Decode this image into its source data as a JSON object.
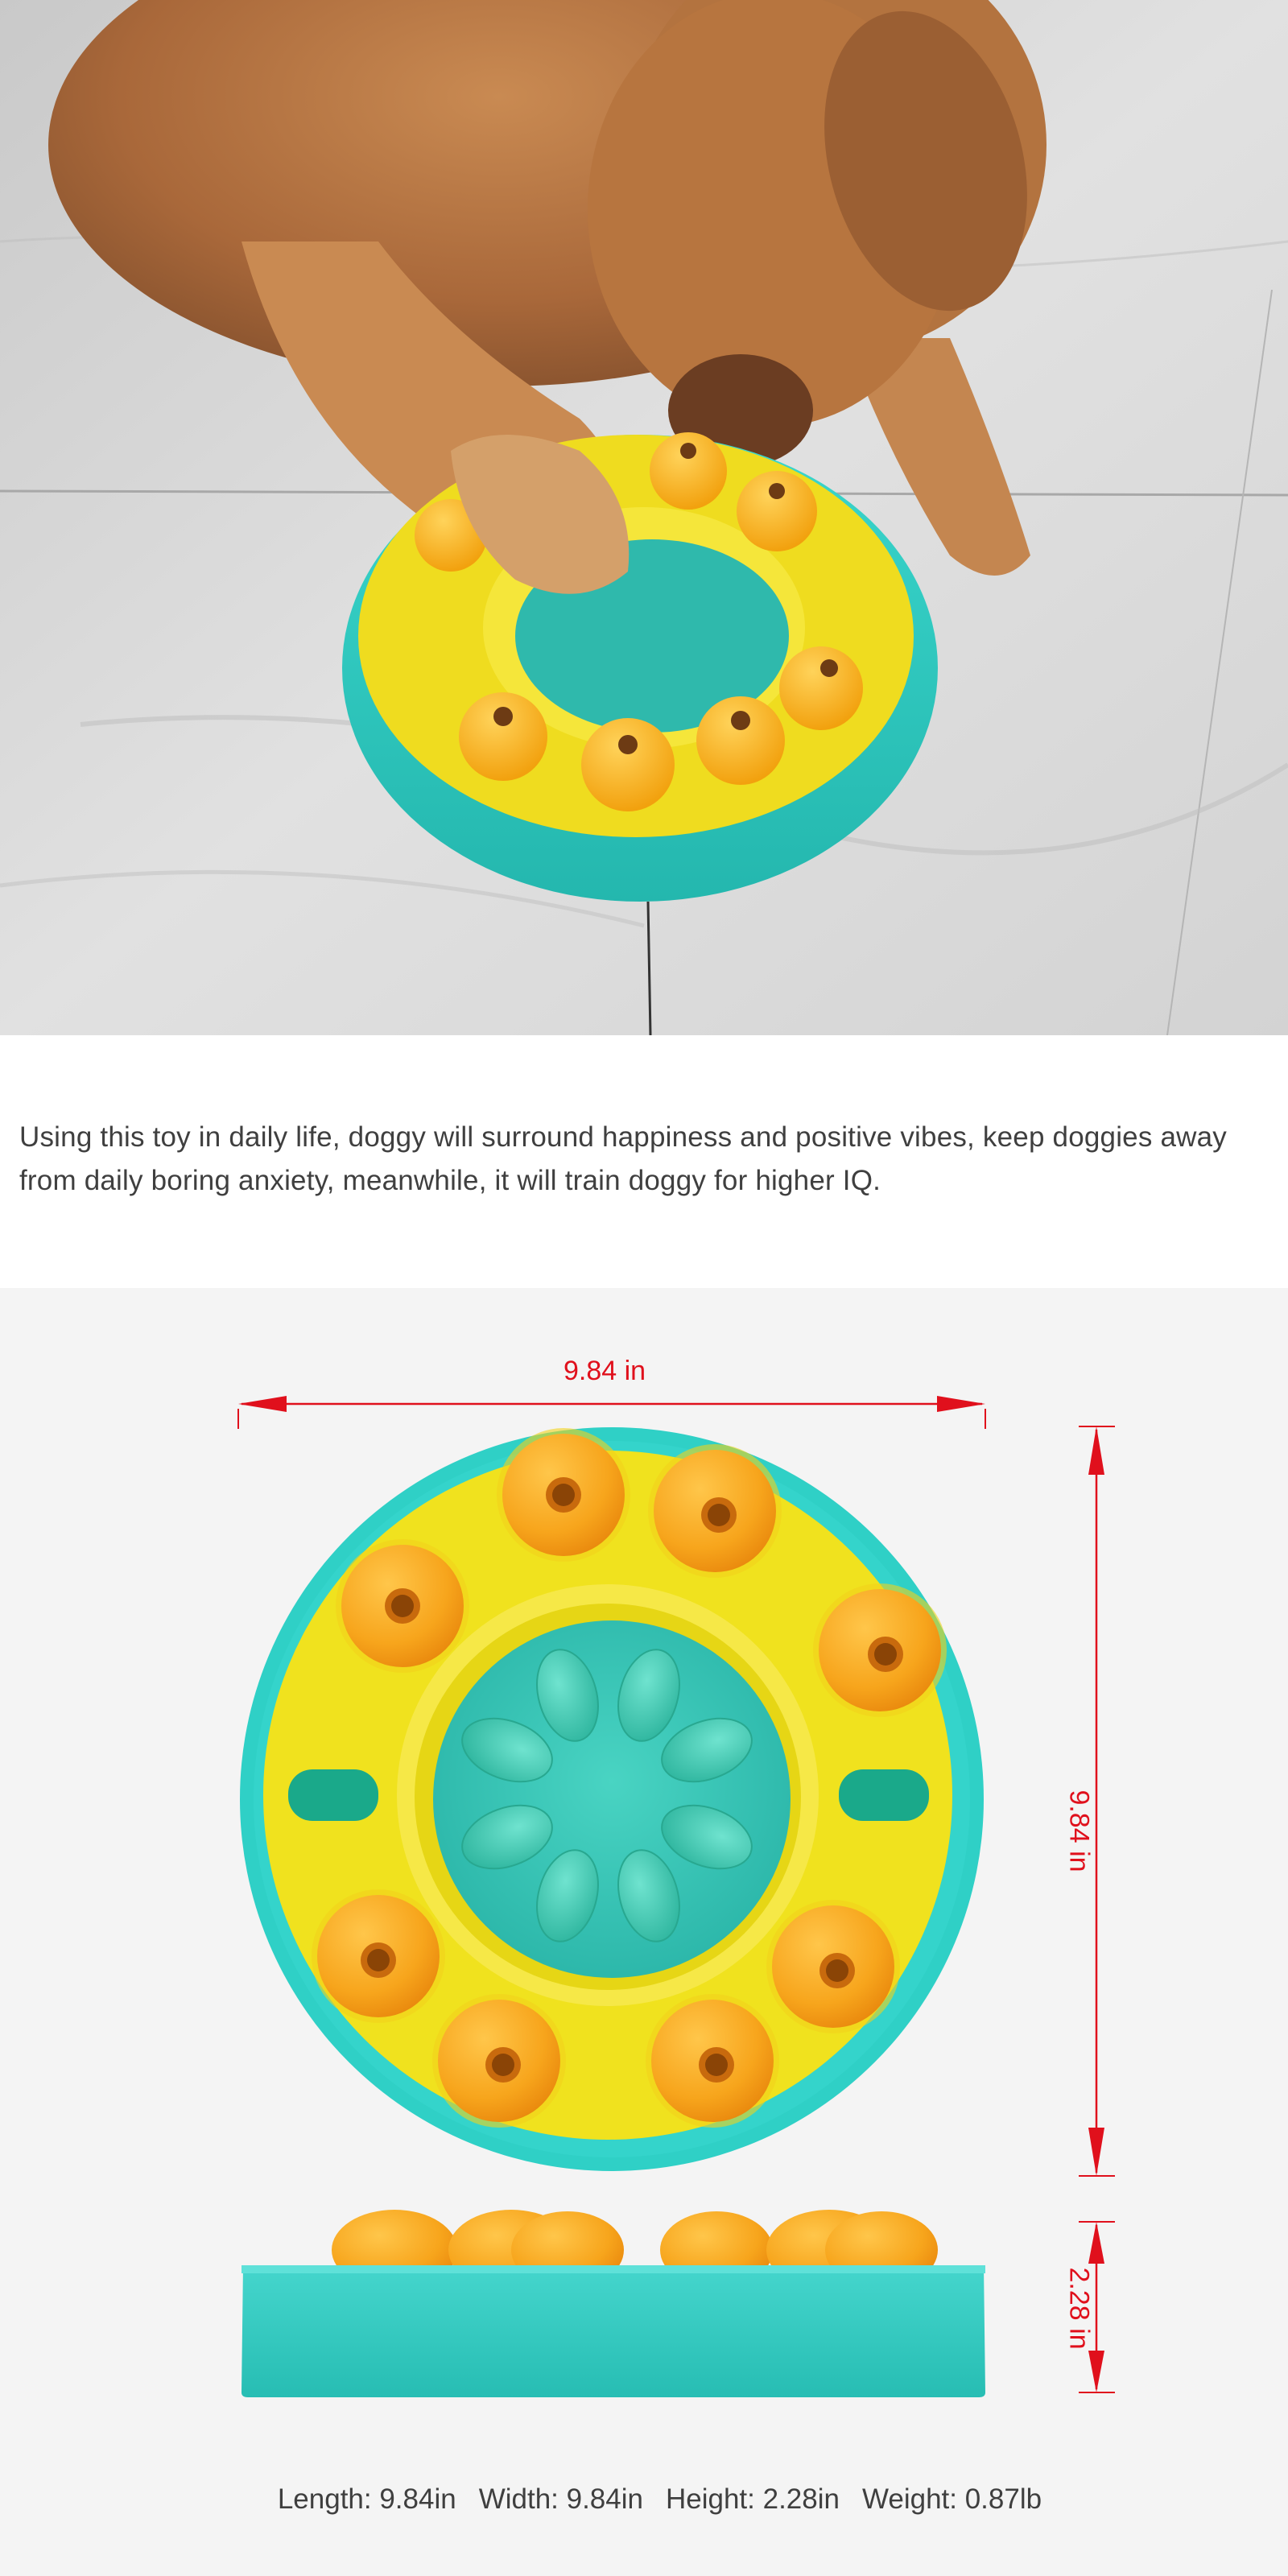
{
  "photo": {
    "subject": "golden-retriever-puppy-playing-with-puzzle-feeder"
  },
  "description": {
    "text": "Using this toy in daily life, doggy will surround happiness and positive vibes, keep doggies away from daily boring anxiety, meanwhile, it will train doggy for higher IQ."
  },
  "dimensions": {
    "width_label": "9.84 in",
    "depth_label": "9.84 in",
    "height_label": "2.28 in"
  },
  "specs": {
    "length": "Length: 9.84in",
    "width": "Width: 9.84in",
    "height": "Height: 2.28in",
    "weight": "Weight: 0.87lb"
  },
  "colors": {
    "base_teal": "#2fd0c6",
    "plate_yellow": "#f2e12a",
    "ball_orange": "#f7a51c",
    "arrow_red": "#e0101c"
  }
}
